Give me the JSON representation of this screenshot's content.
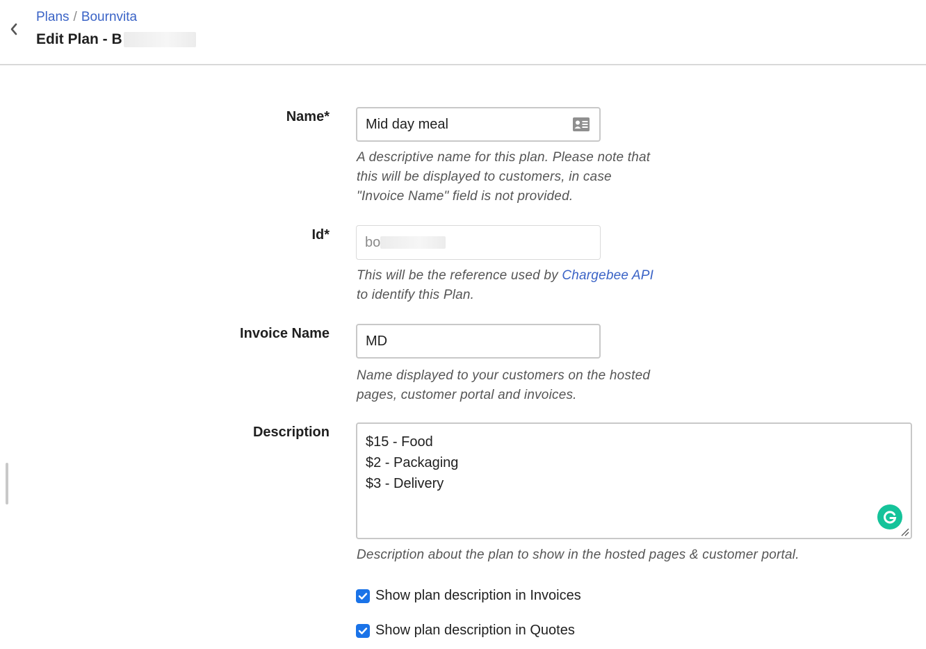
{
  "header": {
    "back_icon": "chevron-left-icon",
    "breadcrumb": {
      "parent": "Plans",
      "separator": "/",
      "current": "Bournvita"
    },
    "title_prefix": "Edit Plan - B"
  },
  "form": {
    "name": {
      "label": "Name*",
      "value": "Mid day meal",
      "icon": "contact-card-icon",
      "help": "A descriptive name for this plan. Please note that this will be displayed to customers, in case \"Invoice Name\" field is not provided."
    },
    "id": {
      "label": "Id*",
      "value": "bo",
      "help_before": "This will be the reference used by",
      "help_link": "Chargebee API",
      "help_after": "to identify this Plan."
    },
    "invoice_name": {
      "label": "Invoice Name",
      "value": "MD",
      "help": "Name displayed to your customers on the hosted pages, customer portal and invoices."
    },
    "description": {
      "label": "Description",
      "lines": [
        "$15 - Food",
        "$2 - Packaging",
        "$3 - Delivery"
      ],
      "help": "Description about the plan to show in the hosted pages & customer portal."
    },
    "checkboxes": {
      "invoices": {
        "label": "Show plan description in Invoices",
        "checked": true
      },
      "quotes": {
        "label": "Show plan description in Quotes",
        "checked": true
      }
    }
  },
  "colors": {
    "link": "#3a63c6",
    "checkbox": "#1a73e8",
    "grammarly": "#15c39a"
  }
}
